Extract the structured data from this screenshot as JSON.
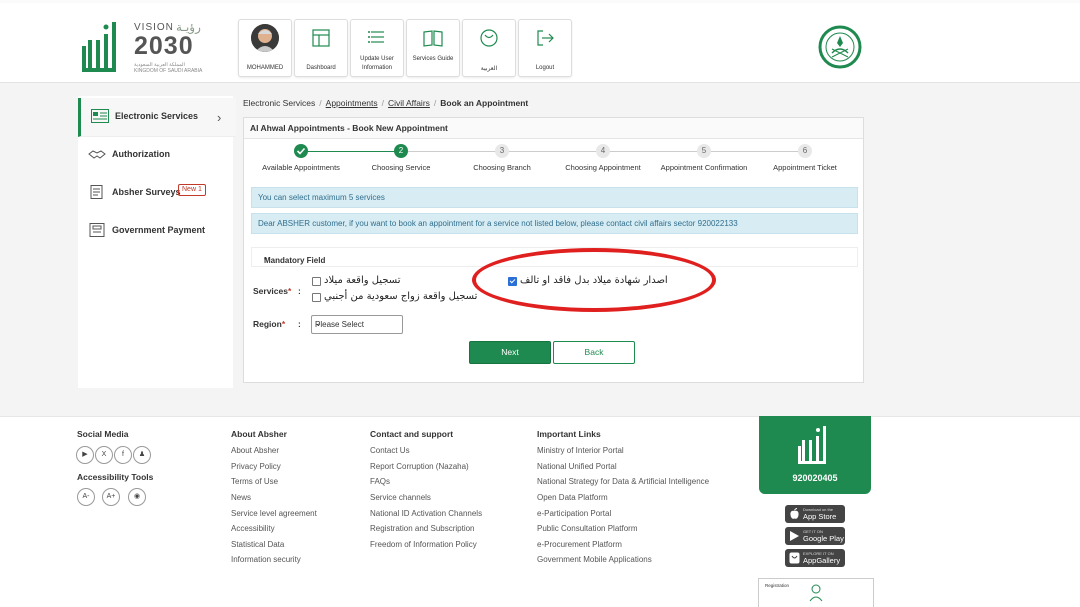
{
  "header": {
    "vision_title": "VISION",
    "vision_ar": "رؤيـة",
    "vision_year": "2030",
    "vision_sub_ar": "المملكة العربية السعودية",
    "vision_sub_en": "KINGDOM OF SAUDI ARABIA",
    "nav": [
      {
        "label": "MOHAMMED",
        "icon": "user-avatar"
      },
      {
        "label": "Dashboard",
        "icon": "dashboard-icon"
      },
      {
        "label": "Update User Information",
        "icon": "update-info-icon"
      },
      {
        "label": "Services Guide",
        "icon": "book-icon"
      },
      {
        "label": "العربية",
        "icon": "language-icon"
      },
      {
        "label": "Logout",
        "icon": "logout-icon"
      }
    ]
  },
  "sidebar": {
    "items": [
      {
        "label": "Electronic Services",
        "icon": "services-icon"
      },
      {
        "label": "Authorization",
        "icon": "handshake-icon"
      },
      {
        "label": "Absher Surveys",
        "icon": "survey-icon",
        "badge": "New 1"
      },
      {
        "label": "Government Payment",
        "icon": "payment-icon"
      }
    ]
  },
  "breadcrumb": {
    "items": [
      "Electronic Services",
      "Appointments",
      "Civil Affairs",
      "Book an Appointment"
    ]
  },
  "panel": {
    "title": "Al Ahwal Appointments - Book New Appointment"
  },
  "steps": [
    {
      "num": "",
      "label": "Available Appointments",
      "state": "done"
    },
    {
      "num": "2",
      "label": "Choosing Service",
      "state": "current"
    },
    {
      "num": "3",
      "label": "Choosing Branch",
      "state": "pending"
    },
    {
      "num": "4",
      "label": "Choosing Appointment",
      "state": "pending"
    },
    {
      "num": "5",
      "label": "Appointment Confirmation",
      "state": "pending"
    },
    {
      "num": "6",
      "label": "Appointment Ticket",
      "state": "pending"
    }
  ],
  "alerts": {
    "max_services": "You can select maximum 5 services",
    "contact_note": "Dear ABSHER customer, if you want to book an appointment for a service not listed below, please contact civil affairs sector 920022133"
  },
  "form": {
    "mandatory_label": "Mandatory Field",
    "services_label": "Services",
    "region_label": "Region",
    "colon": ":",
    "service_options": [
      {
        "label": "تسجيل واقعة ميلاد",
        "checked": false
      },
      {
        "label": "تسجيل واقعة زواج سعودية من أجنبي",
        "checked": false
      },
      {
        "label": "اصدار شهادة ميلاد بدل فاقد او تالف",
        "checked": true
      }
    ],
    "region_placeholder": "Please Select",
    "next_label": "Next",
    "back_label": "Back"
  },
  "footer": {
    "social_media": "Social Media",
    "accessibility_tools": "Accessibility Tools",
    "a_minus": "A-",
    "a_plus": "A+",
    "about_absher": {
      "title": "About Absher",
      "links": [
        "About Absher",
        "Privacy Policy",
        "Terms of Use",
        "News",
        "Service level agreement",
        "Accessibility",
        "Statistical Data",
        "Information security"
      ]
    },
    "contact": {
      "title": "Contact and support",
      "links": [
        "Contact Us",
        "Report Corruption (Nazaha)",
        "FAQs",
        "Service channels",
        "National ID Activation Channels",
        "Registration and Subscription",
        "Freedom of Information Policy"
      ]
    },
    "important": {
      "title": "Important Links",
      "links": [
        "Ministry of Interior Portal",
        "National Unified Portal",
        "National Strategy for Data & Artificial Intelligence",
        "Open Data Platform",
        "e-Participation Portal",
        "Public Consultation Platform",
        "e-Procurement Platform",
        "Government Mobile Applications"
      ]
    },
    "phone": "920020405",
    "stores": [
      {
        "small": "Download on the",
        "big": "App Store"
      },
      {
        "small": "GET IT ON",
        "big": "Google Play"
      },
      {
        "small": "EXPLORE IT ON",
        "big": "AppGallery"
      }
    ],
    "registration": "Registration"
  },
  "colors": {
    "brand_green": "#1f8a4f",
    "info_blue": "#d8ecf3",
    "highlight_red": "#e0201f"
  }
}
